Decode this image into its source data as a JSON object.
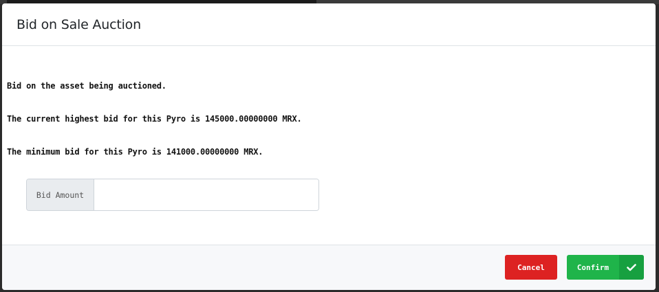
{
  "modal": {
    "title": "Bid on Sale Auction"
  },
  "body": {
    "line1": "Bid on the asset being auctioned.",
    "line2": "The current highest bid for this Pyro is 145000.00000000 MRX.",
    "line3": "The minimum bid for this Pyro is 141000.00000000 MRX."
  },
  "bid_input": {
    "prefix_label": "Bid Amount",
    "value": "",
    "placeholder": ""
  },
  "footer": {
    "cancel_label": "Cancel",
    "confirm_label": "Confirm",
    "confirm_icon": "check-icon"
  },
  "colors": {
    "cancel": "#dd2222",
    "confirm": "#1fb44a"
  }
}
